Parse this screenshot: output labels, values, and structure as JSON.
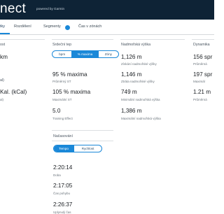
{
  "header": {
    "brand": "nect",
    "brand_sub": "powered by Garmin"
  },
  "tabs": [
    {
      "label": "tky"
    },
    {
      "label": "Rozdělení"
    },
    {
      "label": "Segmenty"
    },
    {
      "label": "Čas v zónách"
    }
  ],
  "segments_badge": "",
  "left_col": {
    "title1": "ost",
    "value1": "km",
    "title2": "al)",
    "value2": "Kal. (kCal)",
    "label2": "al)"
  },
  "heart_rate": {
    "title": "Srdeční tep",
    "toggle": [
      "bpm",
      "% maxima",
      "Zóny"
    ],
    "stats": [
      {
        "value": "95 % maxima",
        "label": "Průměrný ST"
      },
      {
        "value": "105 % maxima",
        "label": "Maximální ST"
      },
      {
        "value": "5.0",
        "label": "Training Effect"
      }
    ]
  },
  "elevation": {
    "title": "Nadmořská výška",
    "stats": [
      {
        "value": "1,126 m",
        "label": "Získání nadmořské výšky"
      },
      {
        "value": "1,146 m",
        "label": "Ztráta nadmořské výšky"
      },
      {
        "value": "749 m",
        "label": "Minimální nadmořská výška"
      },
      {
        "value": "1,386 m",
        "label": "Maximální nadmořská výška"
      }
    ]
  },
  "dynamics": {
    "title": "Dynamika",
    "stats": [
      {
        "value": "156 spr",
        "label": "Průměrná"
      },
      {
        "value": "197 spr",
        "label": "Maximál"
      },
      {
        "value": "1.21 m",
        "label": "Průměrná"
      }
    ]
  },
  "timing": {
    "title": "Načasování",
    "toggle": [
      "Tempo",
      "Rychlost"
    ],
    "stats": [
      {
        "value": "2:20:14",
        "label": "Doba"
      },
      {
        "value": "2:17:05",
        "label": "Čas pohybu"
      },
      {
        "value": "2:26:37",
        "label": "Uplynulý čas"
      }
    ]
  },
  "colors": {
    "header_bg": "#0e2336",
    "accent": "#1a88d8"
  }
}
